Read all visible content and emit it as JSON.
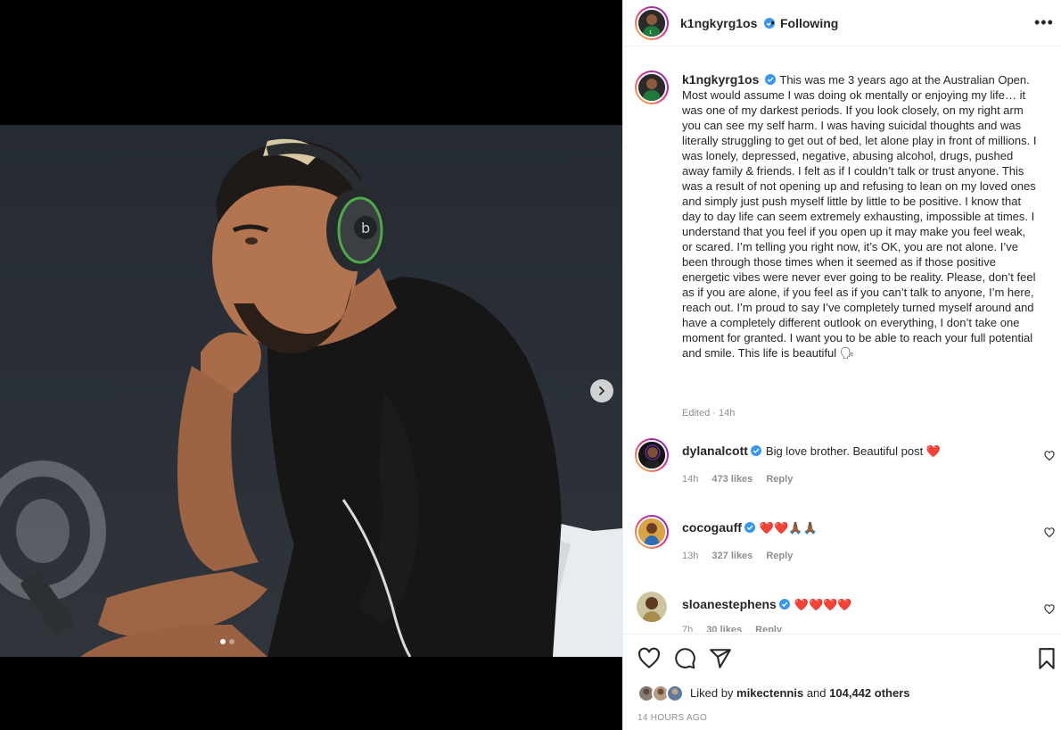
{
  "post": {
    "username": "k1ngkyrg1os",
    "following_label": "Following",
    "separator": "•",
    "more_label": "•••",
    "caption_text": "This was me 3 years ago at the Australian Open. Most would assume I was doing ok mentally or enjoying my life… it was one of my darkest periods. If you look closely, on my right arm you can see my self harm. I was having suicidal thoughts and was literally struggling to get out of bed, let alone play in front of millions. I was lonely, depressed, negative, abusing alcohol, drugs, pushed away family & friends. I felt as if I couldn’t talk or trust anyone. This was a result of not opening up and refusing to lean on my loved ones and simply just push myself little by little to be positive. I know that day to day life can seem extremely exhausting, impossible at times. I understand that you feel if you open up it may make you feel weak, or scared. I’m telling you right now, it’s OK, you are not alone. I’ve been through those times when it seemed as if those positive energetic vibes were never ever going to be reality. Please, don’t feel as if you are alone, if you feel as if you can’t talk to anyone, I’m here, reach out. I’m proud to say I’ve completely turned myself around and have a completely different outlook on everything, I don’t take one moment for granted. I want you to be able to reach your full potential and smile. This life is beautiful 🗣",
    "edited_label": "Edited · 14h"
  },
  "comments": [
    {
      "username": "dylanalcott",
      "text": "Big love brother. Beautiful post ❤️",
      "time": "14h",
      "likes": "473 likes",
      "reply": "Reply"
    },
    {
      "username": "cocogauff",
      "text": "❤️❤️🙏🏾🙏🏾",
      "time": "13h",
      "likes": "327 likes",
      "reply": "Reply"
    },
    {
      "username": "sloanestephens",
      "text": "❤️❤️❤️❤️",
      "time": "7h",
      "likes": "30 likes",
      "reply": "Reply"
    }
  ],
  "footer": {
    "liked_by_prefix": "Liked by",
    "liked_by_user": "mikectennis",
    "and_label": "and",
    "others_count": "104,442 others",
    "time_ago": "14 HOURS AGO"
  },
  "colors": {
    "verified": "#3897f0",
    "heart": "#ed4956",
    "text": "#262626",
    "muted": "#8e8e8e"
  },
  "icons": [
    "chevron-right-icon",
    "verified-icon",
    "heart-icon",
    "comment-icon",
    "share-icon",
    "bookmark-icon",
    "more-icon"
  ],
  "media": {
    "slide_count": 2,
    "active_slide": 1
  }
}
